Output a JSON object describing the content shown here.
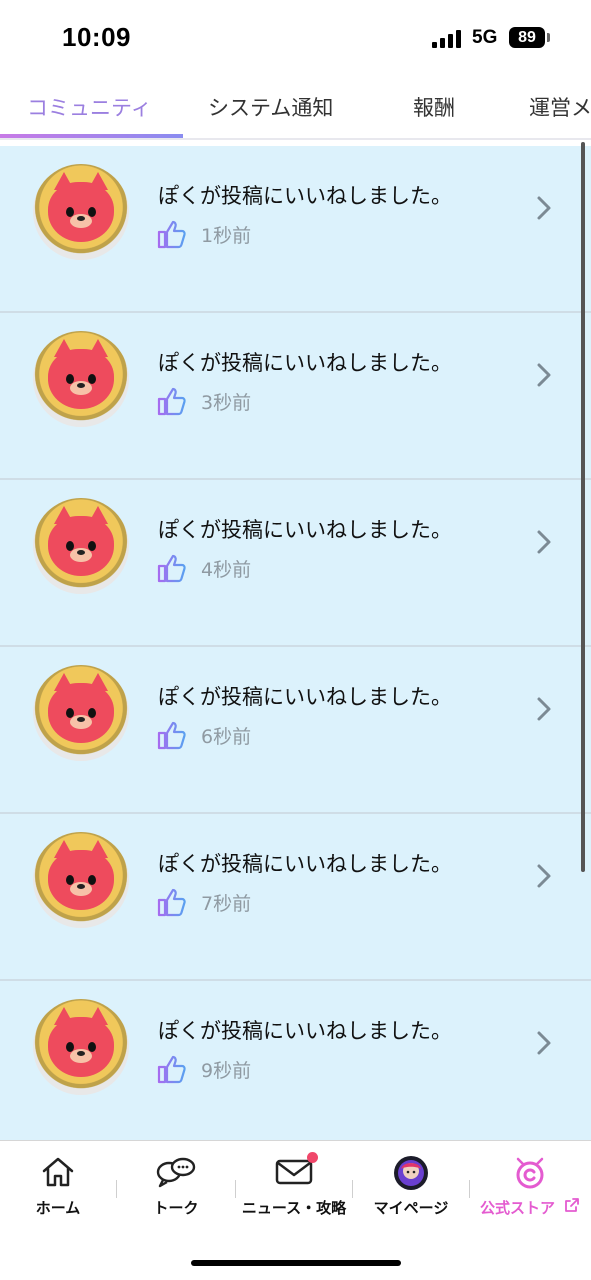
{
  "status_bar": {
    "time": "10:09",
    "network": "5G",
    "battery": "89"
  },
  "tabs": [
    {
      "label": "コミュニティ",
      "active": true
    },
    {
      "label": "システム通知",
      "active": false
    },
    {
      "label": "報酬",
      "active": false
    },
    {
      "label": "運営メ",
      "active": false
    }
  ],
  "notifications": [
    {
      "message": "ぽくが投稿にいいねしました。",
      "time": "1秒前"
    },
    {
      "message": "ぽくが投稿にいいねしました。",
      "time": "3秒前"
    },
    {
      "message": "ぽくが投稿にいいねしました。",
      "time": "4秒前"
    },
    {
      "message": "ぽくが投稿にいいねしました。",
      "time": "6秒前"
    },
    {
      "message": "ぽくが投稿にいいねしました。",
      "time": "7秒前"
    },
    {
      "message": "ぽくが投稿にいいねしました。",
      "time": "9秒前"
    }
  ],
  "bottom_nav": [
    {
      "label": "ホーム",
      "icon": "home-icon"
    },
    {
      "label": "トーク",
      "icon": "chat-icon"
    },
    {
      "label": "ニュース・攻略",
      "icon": "mail-icon",
      "badge": true
    },
    {
      "label": "マイページ",
      "icon": "avatar-icon"
    },
    {
      "label": "公式ストア",
      "icon": "store-icon"
    }
  ],
  "colors": {
    "accent": "#9b7fe0",
    "row_background": "#dcf2fc",
    "store": "#e45bd0",
    "badge": "#f0476a"
  }
}
